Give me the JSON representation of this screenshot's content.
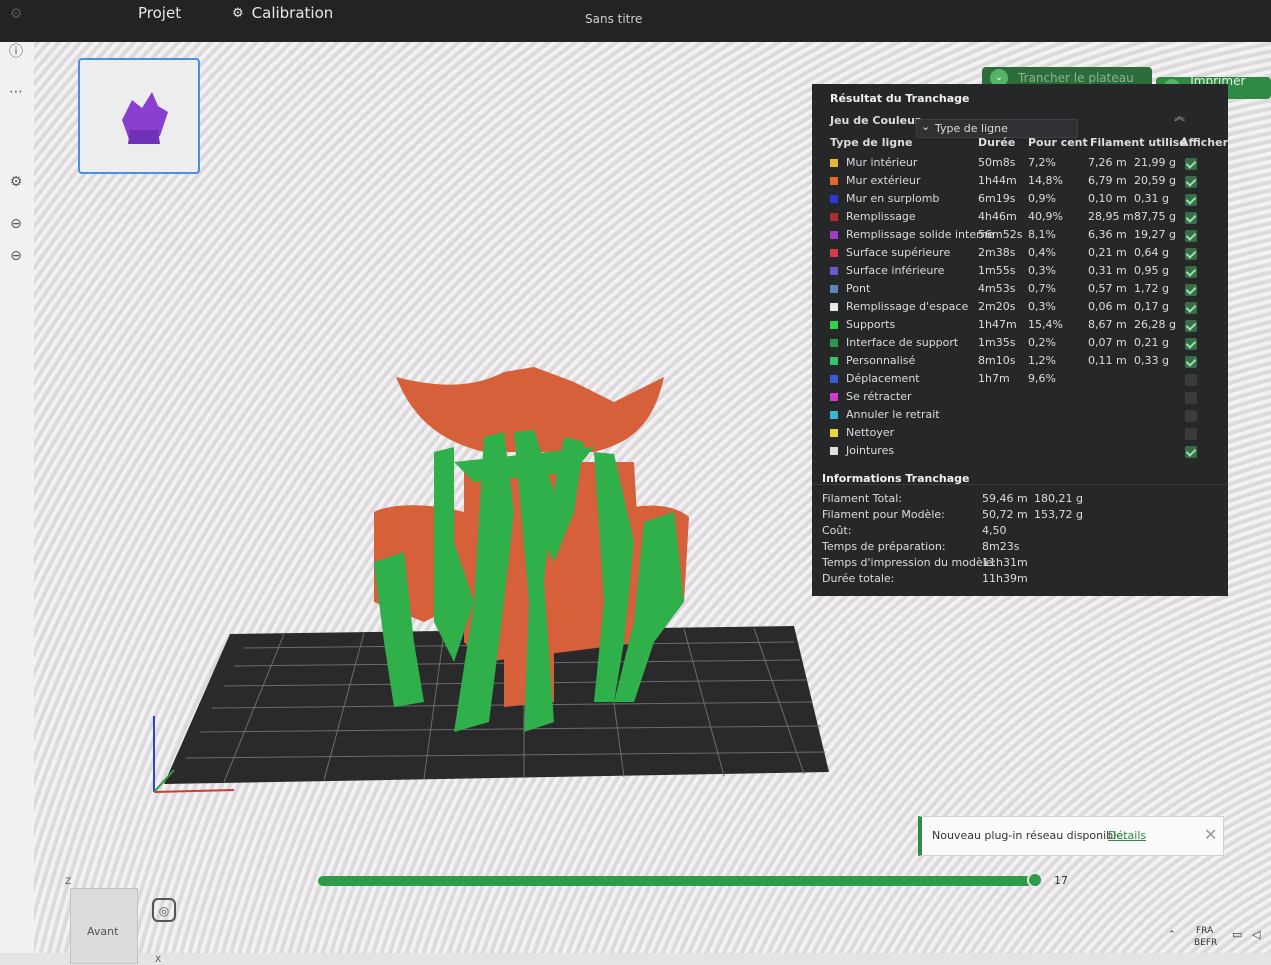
{
  "topbar": {
    "tab_projet": "Projet",
    "tab_calibration": "Calibration",
    "doc_title": "Sans titre"
  },
  "toolbar": {
    "slice_button": "Trancher le plateau",
    "print_button": "Imprimer plate"
  },
  "slice_panel": {
    "title": "Résultat du Tranchage",
    "color_scheme_label": "Jeu de Couleur",
    "color_scheme_value": "Type de ligne",
    "columns": [
      "Type de ligne",
      "Durée",
      "Pour cent",
      "Filament utilisé",
      "Afficher"
    ],
    "rows": [
      {
        "name": "Mur intérieur",
        "color": "#e5b53c",
        "duration": "50m8s",
        "percent": "7,2%",
        "length": "7,26 m",
        "weight": "21,99 g",
        "show": true
      },
      {
        "name": "Mur extérieur",
        "color": "#e0662a",
        "duration": "1h44m",
        "percent": "14,8%",
        "length": "6,79 m",
        "weight": "20,59 g",
        "show": true
      },
      {
        "name": "Mur en surplomb",
        "color": "#2a38d6",
        "duration": "6m19s",
        "percent": "0,9%",
        "length": "0,10 m",
        "weight": "0,31 g",
        "show": true
      },
      {
        "name": "Remplissage",
        "color": "#b22b2b",
        "duration": "4h46m",
        "percent": "40,9%",
        "length": "28,95 m",
        "weight": "87,75 g",
        "show": true
      },
      {
        "name": "Remplissage solide interne",
        "color": "#a23bc4",
        "duration": "56m52s",
        "percent": "8,1%",
        "length": "6,36 m",
        "weight": "19,27 g",
        "show": true
      },
      {
        "name": "Surface supérieure",
        "color": "#d63b4a",
        "duration": "2m38s",
        "percent": "0,4%",
        "length": "0,21 m",
        "weight": "0,64 g",
        "show": true
      },
      {
        "name": "Surface inférieure",
        "color": "#6a5bd0",
        "duration": "1m55s",
        "percent": "0,3%",
        "length": "0,31 m",
        "weight": "0,95 g",
        "show": true
      },
      {
        "name": "Pont",
        "color": "#5a86b8",
        "duration": "4m53s",
        "percent": "0,7%",
        "length": "0,57 m",
        "weight": "1,72 g",
        "show": true
      },
      {
        "name": "Remplissage d'espace",
        "color": "#e8e8e8",
        "duration": "2m20s",
        "percent": "0,3%",
        "length": "0,06 m",
        "weight": "0,17 g",
        "show": true
      },
      {
        "name": "Supports",
        "color": "#2bd34a",
        "duration": "1h47m",
        "percent": "15,4%",
        "length": "8,67 m",
        "weight": "26,28 g",
        "show": true
      },
      {
        "name": "Interface de support",
        "color": "#2b9a4a",
        "duration": "1m35s",
        "percent": "0,2%",
        "length": "0,07 m",
        "weight": "0,21 g",
        "show": true
      },
      {
        "name": "Personnalisé",
        "color": "#3ac46a",
        "duration": "8m10s",
        "percent": "1,2%",
        "length": "0,11 m",
        "weight": "0,33 g",
        "show": true
      },
      {
        "name": "Déplacement",
        "color": "#3a5ad0",
        "duration": "1h7m",
        "percent": "9,6%",
        "length": "",
        "weight": "",
        "show": false
      },
      {
        "name": "Se rétracter",
        "color": "#d03ad0",
        "duration": "",
        "percent": "",
        "length": "",
        "weight": "",
        "show": false
      },
      {
        "name": "Annuler le retrait",
        "color": "#3ab8d0",
        "duration": "",
        "percent": "",
        "length": "",
        "weight": "",
        "show": false
      },
      {
        "name": "Nettoyer",
        "color": "#e8d83a",
        "duration": "",
        "percent": "",
        "length": "",
        "weight": "",
        "show": false
      },
      {
        "name": "Jointures",
        "color": "#e0e0e0",
        "duration": "",
        "percent": "",
        "length": "",
        "weight": "",
        "show": true
      }
    ],
    "info_title": "Informations Tranchage",
    "info": [
      {
        "label": "Filament Total:",
        "v1": "59,46 m",
        "v2": "180,21 g"
      },
      {
        "label": "Filament pour Modèle:",
        "v1": "50,72 m",
        "v2": "153,72 g"
      },
      {
        "label": "Coût:",
        "v1": "4,50",
        "v2": ""
      },
      {
        "label": "Temps de préparation:",
        "v1": "8m23s",
        "v2": ""
      },
      {
        "label": "Temps d'impression du modèle:",
        "v1": "11h31m",
        "v2": ""
      },
      {
        "label": "Durée totale:",
        "v1": "11h39m",
        "v2": ""
      }
    ]
  },
  "notification": {
    "text": "Nouveau plug-in réseau disponible.",
    "link": "Détails"
  },
  "layer_slider": {
    "value": "17"
  },
  "view_cube": {
    "label": "Avant",
    "axis_z": "Z",
    "axis_x": "X"
  },
  "taskbar": {
    "lang_1": "FRA",
    "lang_2": "BEFR"
  },
  "icons": [
    "projet-icon",
    "calibration-icon",
    "settings-icon",
    "chevron-down-icon",
    "close-icon",
    "wifi-icon",
    "speaker-icon"
  ]
}
